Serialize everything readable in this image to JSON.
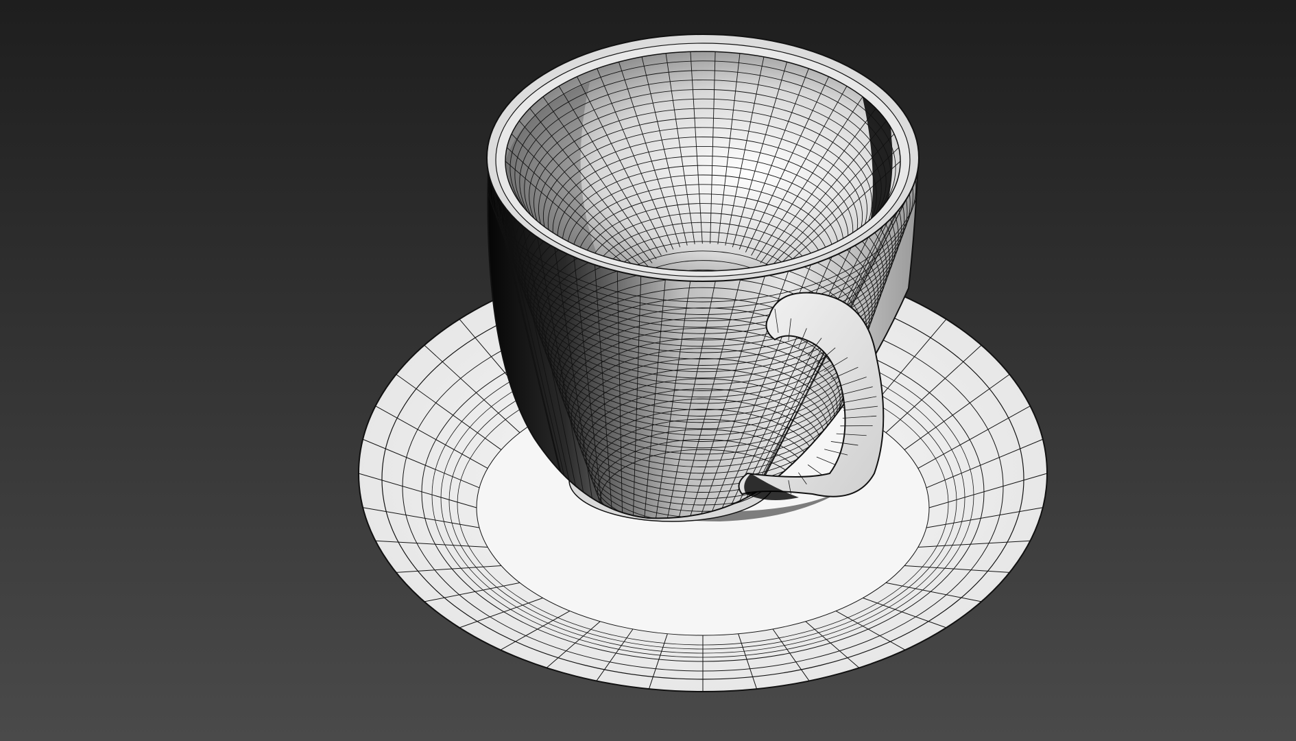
{
  "viewport": {
    "background_top": "#1f1f1f",
    "background_bottom": "#4a4a4a",
    "shading_mode": "wireframe-on-shaded"
  },
  "scene": {
    "objects": [
      {
        "name": "cup",
        "icon": "teacup-mesh",
        "color": "#e8e8e8",
        "wire_color": "#111111"
      },
      {
        "name": "saucer",
        "icon": "saucer-mesh",
        "color": "#f0f0f0",
        "wire_color": "#111111"
      },
      {
        "name": "handle",
        "icon": "handle-mesh",
        "color": "#efefef",
        "wire_color": "#111111"
      }
    ]
  }
}
